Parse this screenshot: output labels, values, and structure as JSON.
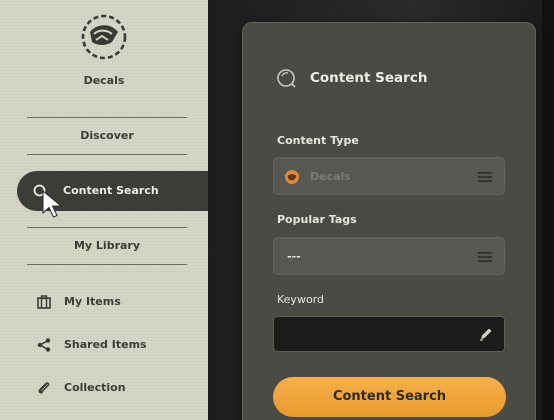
{
  "app": {
    "title": "Decals",
    "logo_icon": "decal-logo-icon"
  },
  "sidebar": {
    "discover": "Discover",
    "active": {
      "label": "Content Search",
      "icon": "search-icon"
    },
    "library": "My Library",
    "items": [
      {
        "label": "My Items",
        "icon": "briefcase-icon"
      },
      {
        "label": "Shared Items",
        "icon": "share-icon"
      },
      {
        "label": "Collection",
        "icon": "paperclip-icon"
      }
    ]
  },
  "panel": {
    "title": "Content Search",
    "content_type": {
      "label": "Content Type",
      "value": "Decals",
      "icon": "decal-icon"
    },
    "popular_tags": {
      "label": "Popular Tags",
      "value": "---"
    },
    "keyword": {
      "label": "Keyword",
      "value": ""
    },
    "submit": "Content Search"
  },
  "colors": {
    "sidebar_bg": "#d5d6c8",
    "active_item_bg": "#3c3d38",
    "panel_bg": "#4a4b45",
    "accent": "#f0a63c"
  }
}
